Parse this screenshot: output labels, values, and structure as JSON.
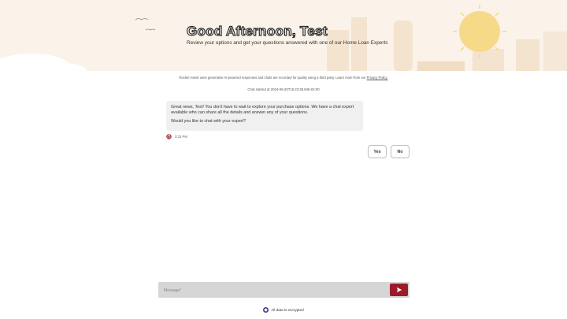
{
  "header": {
    "greeting": "Good Afternoon, Test",
    "subtitle": "Review your options and get your questions answered with one of our Home Loan Experts"
  },
  "disclaimer": {
    "text": "Rocket Assist uses generative AI-powered responses and chats are recorded for quality using a third party. Learn more from our ",
    "link": "Privacy Policy."
  },
  "chat": {
    "started": "Chat started at 2024-06-20T15:23:38.845-04:00",
    "message": {
      "paragraph1": "Great news, Test! You don't have to wait to explore your purchase options. We have a chat expert available who can share all the details and answer any of your questions.",
      "paragraph2": "Would you like to chat with your expert?",
      "time": "3:23 PM"
    },
    "quick_replies": {
      "yes": "Yes",
      "no": "No"
    }
  },
  "composer": {
    "placeholder": "Message*"
  },
  "footer": {
    "encrypted": "All data is encrypted"
  },
  "colors": {
    "brand": "#9b1b28",
    "hero_bg": "#fbf3ea",
    "sun": "#f7d98a"
  }
}
